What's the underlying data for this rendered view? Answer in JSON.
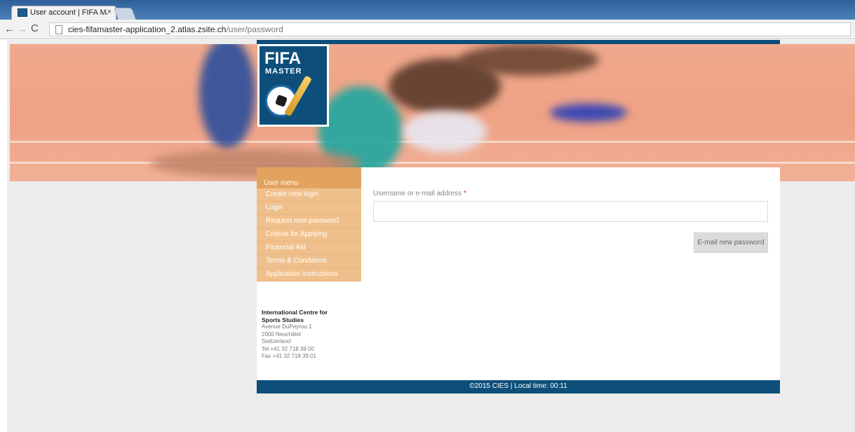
{
  "browser": {
    "tab_title": "User account | FIFA MAST",
    "tab_close": "×",
    "url_host": "cies-fifamaster-application_2.atlas.zsite.ch",
    "url_path": "/user/password"
  },
  "logo": {
    "line1": "FIFA",
    "line2": "MASTER"
  },
  "sidebar": {
    "title": "User menu",
    "items": [
      {
        "label": "Create new login"
      },
      {
        "label": "Login"
      },
      {
        "label": "Request new password"
      },
      {
        "label": "Criteria for Applying"
      },
      {
        "label": "Financial Aid"
      },
      {
        "label": "Terms & Conditions"
      },
      {
        "label": "Application Instructions"
      }
    ],
    "address": {
      "org_line1": "International Centre for",
      "org_line2": "Sports Studies",
      "street": "Avenue DuPeyrou 1",
      "city": "2000 Neuchâtel",
      "country": "Switzerland",
      "tel": "Tel +41 32 718 39 00",
      "fax": "Fax +41 32 718 39 01"
    }
  },
  "form": {
    "field_label": "Username or e-mail address",
    "required_mark": "*",
    "input_value": "",
    "submit_label": "E-mail new password"
  },
  "footer": {
    "text": "©2015 CIES | Local time: 00:11"
  },
  "colors": {
    "brand_blue": "#0d4f7a",
    "menu_orange": "#f0c08c",
    "menu_title": "#e2a35f"
  }
}
